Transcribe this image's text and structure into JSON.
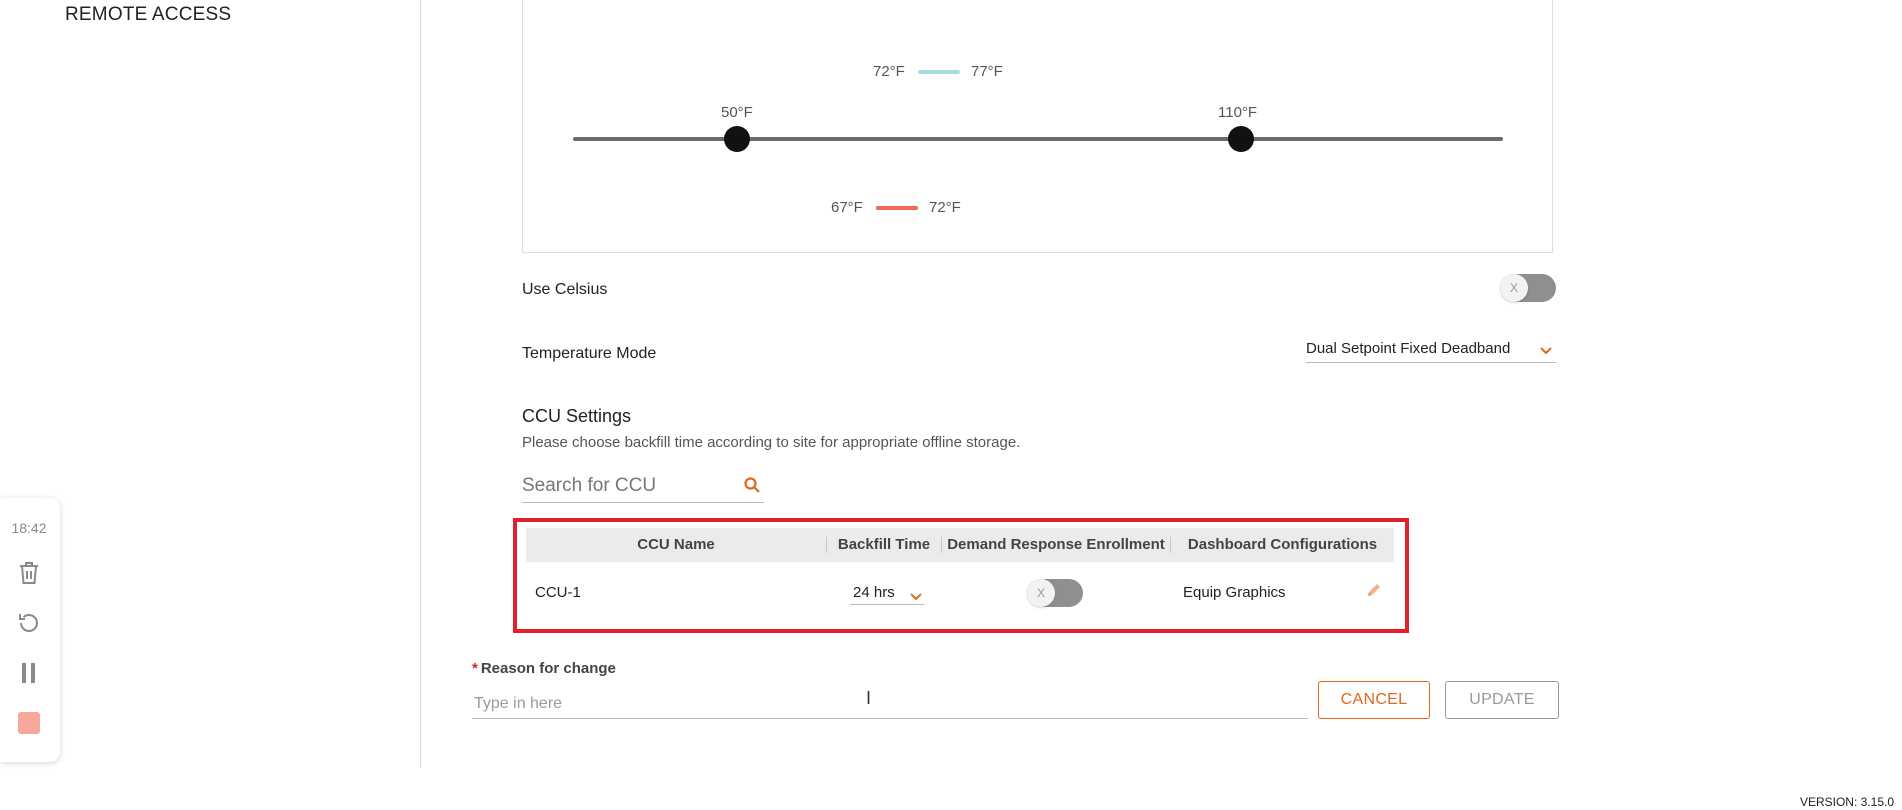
{
  "sidebar": {
    "remote_access_label": "REMOTE ACCESS"
  },
  "recorder": {
    "time": "18:42"
  },
  "range": {
    "cooling": {
      "min_label": "72°F",
      "max_label": "77°F",
      "color": "#a7dbe0"
    },
    "heating": {
      "min_label": "67°F",
      "max_label": "72°F",
      "color": "#f2675a"
    },
    "slider": {
      "min_label": "50°F",
      "max_label": "110°F"
    }
  },
  "settings": {
    "use_celsius_label": "Use Celsius",
    "use_celsius_on": false,
    "toggle_off_glyph": "X",
    "temperature_mode_label": "Temperature Mode",
    "temperature_mode_value": "Dual Setpoint Fixed Deadband"
  },
  "ccu_settings": {
    "title": "CCU Settings",
    "subtitle": "Please choose backfill time according to site for appropriate offline storage.",
    "search_placeholder": "Search for CCU",
    "columns": [
      "CCU Name",
      "Backfill Time",
      "Demand Response Enrollment",
      "Dashboard Configurations"
    ],
    "rows": [
      {
        "name": "CCU-1",
        "backfill_time": "24 hrs",
        "demand_response_enrolled": false,
        "dashboard_configuration": "Equip Graphics"
      }
    ]
  },
  "reason": {
    "label": "Reason for change",
    "required_mark": "*",
    "placeholder": "Type in here"
  },
  "actions": {
    "cancel_label": "CANCEL",
    "update_label": "UPDATE"
  },
  "footer": {
    "version": "VERSION: 3.15.0"
  },
  "colors": {
    "accent": "#e2671c",
    "highlight": "#e0202c"
  }
}
